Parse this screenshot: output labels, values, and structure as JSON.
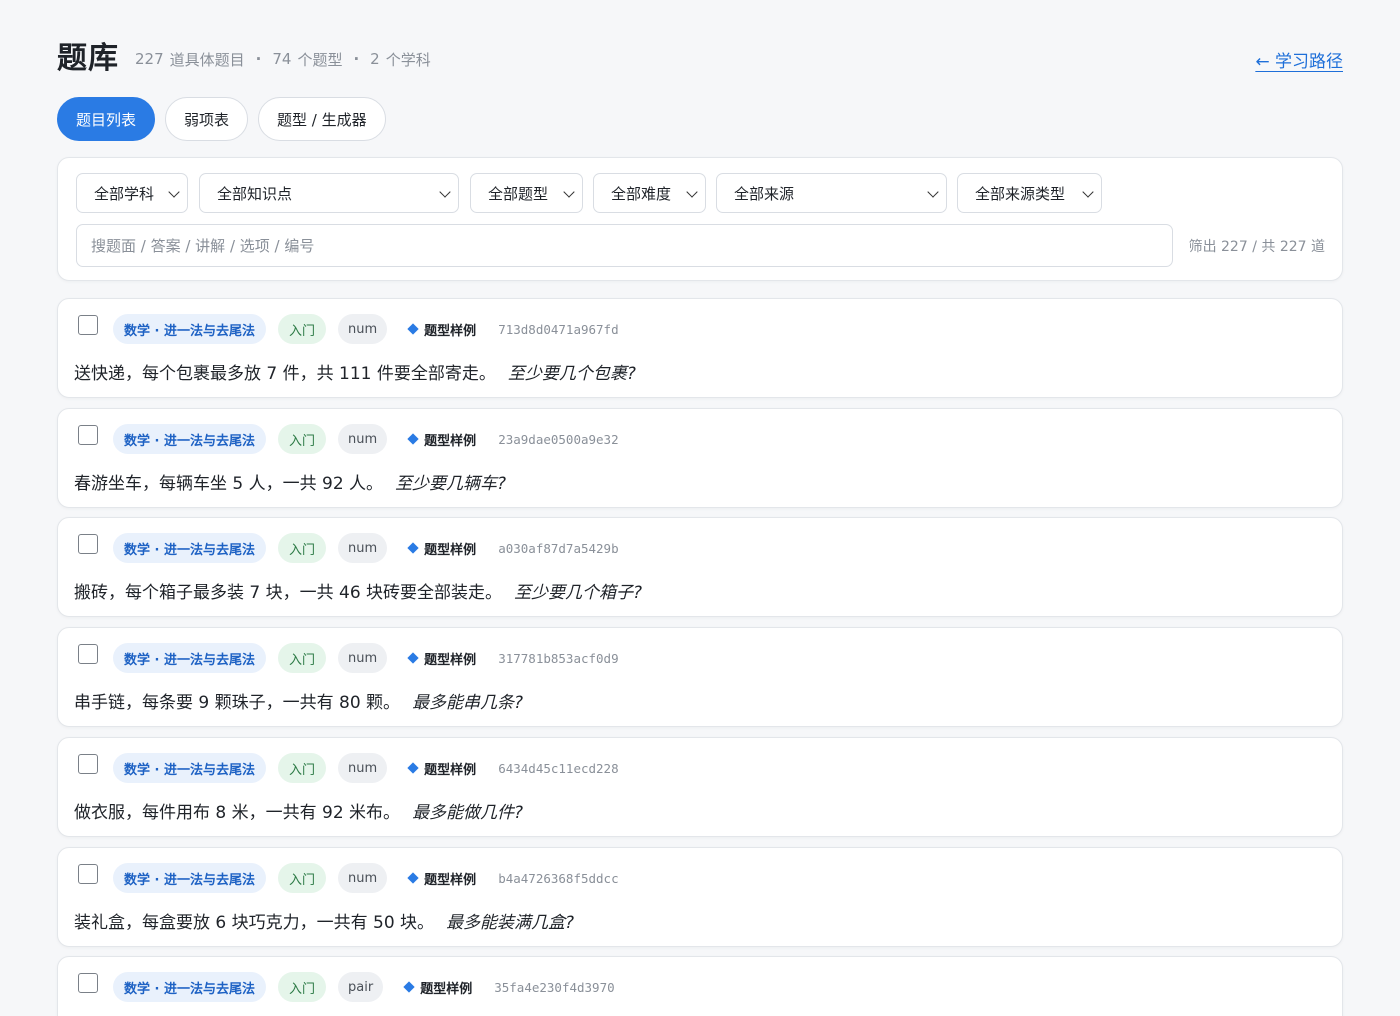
{
  "header": {
    "title": "题库",
    "stats": [
      {
        "num": "227",
        "label": "道具体题目"
      },
      {
        "num": "74",
        "label": "个题型"
      },
      {
        "num": "2",
        "label": "个学科"
      }
    ],
    "separator": "·",
    "back_link": "← 学习路径"
  },
  "tabs": [
    {
      "label": "题目列表",
      "active": true
    },
    {
      "label": "弱项表",
      "active": false
    },
    {
      "label": "题型 / 生成器",
      "active": false
    }
  ],
  "filters": {
    "subject": "全部学科",
    "knowledge": "全部知识点",
    "qtype": "全部题型",
    "difficulty": "全部难度",
    "source": "全部来源",
    "source_type": "全部来源类型"
  },
  "search": {
    "placeholder": "搜题面 / 答案 / 讲解 / 选项 / 编号",
    "value": ""
  },
  "count_text": "筛出 227 / 共 227 道",
  "questions": [
    {
      "subject": "数学 · 进一法与去尾法",
      "level": "入门",
      "kind": "num",
      "sample": "题型样例",
      "id": "713d8d0471a967fd",
      "text": "送快递，每个包裹最多放 7 件，共 111 件要全部寄走。",
      "ask": "至少要几个包裹?"
    },
    {
      "subject": "数学 · 进一法与去尾法",
      "level": "入门",
      "kind": "num",
      "sample": "题型样例",
      "id": "23a9dae0500a9e32",
      "text": "春游坐车，每辆车坐 5 人，一共 92 人。",
      "ask": "至少要几辆车?"
    },
    {
      "subject": "数学 · 进一法与去尾法",
      "level": "入门",
      "kind": "num",
      "sample": "题型样例",
      "id": "a030af87d7a5429b",
      "text": "搬砖，每个箱子最多装 7 块，一共 46 块砖要全部装走。",
      "ask": "至少要几个箱子?"
    },
    {
      "subject": "数学 · 进一法与去尾法",
      "level": "入门",
      "kind": "num",
      "sample": "题型样例",
      "id": "317781b853acf0d9",
      "text": "串手链，每条要 9 颗珠子，一共有 80 颗。",
      "ask": "最多能串几条?"
    },
    {
      "subject": "数学 · 进一法与去尾法",
      "level": "入门",
      "kind": "num",
      "sample": "题型样例",
      "id": "6434d45c11ecd228",
      "text": "做衣服，每件用布 8 米，一共有 92 米布。",
      "ask": "最多能做几件?"
    },
    {
      "subject": "数学 · 进一法与去尾法",
      "level": "入门",
      "kind": "num",
      "sample": "题型样例",
      "id": "b4a4726368f5ddcc",
      "text": "装礼盒，每盒要放 6 块巧克力，一共有 50 块。",
      "ask": "最多能装满几盒?"
    },
    {
      "subject": "数学 · 进一法与去尾法",
      "level": "入门",
      "kind": "pair",
      "sample": "题型样例",
      "id": "35fa4e230f4d3970",
      "text": "",
      "ask": ""
    }
  ]
}
